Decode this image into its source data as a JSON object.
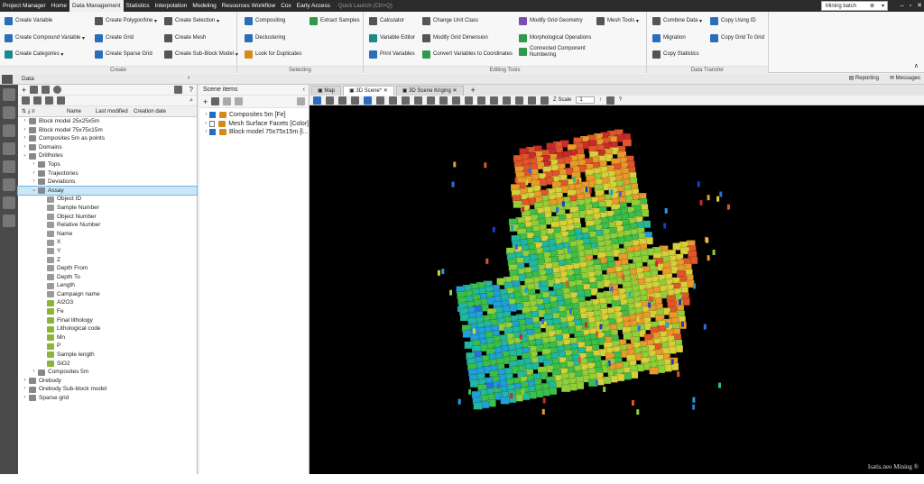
{
  "menubar": {
    "items": [
      "Project Manager",
      "Home",
      "Data Management",
      "Statistics",
      "Interpolation",
      "Modeling",
      "Resources Workflow",
      "Cox",
      "Early Access"
    ],
    "active_index": 2,
    "quick_launch": "Quick Launch (Ctrl+Q)",
    "project_name": "Mining batch"
  },
  "ribbon": {
    "create": {
      "title": "Create",
      "col1": [
        "Create Variable",
        "Create Compound Variable",
        "Create Categories"
      ],
      "col2": [
        "Create Polygon/line",
        "Create Grid",
        "Create Sparse Grid"
      ],
      "col3": [
        "Create Selection",
        "Create Mesh",
        "Create Sub-Block Model"
      ]
    },
    "selecting": {
      "title": "Selecting",
      "col1": [
        "Compositing",
        "Declustering",
        "Look for Duplicates"
      ],
      "col2": [
        "Extract Samples"
      ]
    },
    "editing": {
      "title": "Editing Tools",
      "col1": [
        "Calculator",
        "Variable Editor",
        "Print Variables"
      ],
      "col2": [
        "Change Unit Class",
        "Modify Grid Dimension",
        "Convert Variables to Coordinates"
      ],
      "col3": [
        "Modify Grid Geometry",
        "Morphological Operations",
        "Connected Component Numbering"
      ],
      "col4": [
        "Mesh Tools"
      ]
    },
    "transfer": {
      "title": "Data Transfer",
      "col1": [
        "Combine Data",
        "Migration",
        "Copy Statistics"
      ],
      "col2": [
        "Copy Using ID",
        "Copy Grid To Grid"
      ]
    }
  },
  "tabrow": {
    "left_label": "Data",
    "reporting": "Reporting",
    "messages": "Messages"
  },
  "datapanel": {
    "columns": [
      "Name",
      "Last modified",
      "Creation date"
    ],
    "tree": [
      {
        "label": "Block model 25x25x5m",
        "depth": 0,
        "exp": ">"
      },
      {
        "label": "Block model 75x75x15m",
        "depth": 0,
        "exp": ">"
      },
      {
        "label": "Composites 5m as points",
        "depth": 0,
        "exp": ">"
      },
      {
        "label": "Domains",
        "depth": 0,
        "exp": ">"
      },
      {
        "label": "Drillholes",
        "depth": 0,
        "exp": "v"
      },
      {
        "label": "Tops",
        "depth": 1,
        "exp": ">"
      },
      {
        "label": "Trajectories",
        "depth": 1,
        "exp": ">"
      },
      {
        "label": "Deviations",
        "depth": 1,
        "exp": ">"
      },
      {
        "label": "Assay",
        "depth": 1,
        "exp": "v",
        "selected": true
      },
      {
        "label": "Object ID",
        "depth": 2,
        "exp": ""
      },
      {
        "label": "Sample Number",
        "depth": 2,
        "exp": ""
      },
      {
        "label": "Object Number",
        "depth": 2,
        "exp": ""
      },
      {
        "label": "Relative Number",
        "depth": 2,
        "exp": ""
      },
      {
        "label": "Name",
        "depth": 2,
        "exp": ""
      },
      {
        "label": "X",
        "depth": 2,
        "exp": ""
      },
      {
        "label": "Y",
        "depth": 2,
        "exp": ""
      },
      {
        "label": "Z",
        "depth": 2,
        "exp": ""
      },
      {
        "label": "Depth From",
        "depth": 2,
        "exp": ""
      },
      {
        "label": "Depth To",
        "depth": 2,
        "exp": ""
      },
      {
        "label": "Length",
        "depth": 2,
        "exp": ""
      },
      {
        "label": "Campaign name",
        "depth": 2,
        "exp": ""
      },
      {
        "label": "Al2O3",
        "depth": 2,
        "exp": ""
      },
      {
        "label": "Fe",
        "depth": 2,
        "exp": ""
      },
      {
        "label": "Final lithology",
        "depth": 2,
        "exp": ""
      },
      {
        "label": "Lithological code",
        "depth": 2,
        "exp": ""
      },
      {
        "label": "Mn",
        "depth": 2,
        "exp": ""
      },
      {
        "label": "P",
        "depth": 2,
        "exp": ""
      },
      {
        "label": "Sample length",
        "depth": 2,
        "exp": ""
      },
      {
        "label": "SiO2",
        "depth": 2,
        "exp": ""
      },
      {
        "label": "Composites 5m",
        "depth": 1,
        "exp": ">"
      },
      {
        "label": "Orebody",
        "depth": 0,
        "exp": ">"
      },
      {
        "label": "Orebody Sub-block model",
        "depth": 0,
        "exp": ">"
      },
      {
        "label": "Sparse grid",
        "depth": 0,
        "exp": ">"
      }
    ]
  },
  "scene": {
    "title": "Scene items",
    "items": [
      {
        "label": "Composites 5m [Fe]",
        "checked": true
      },
      {
        "label": "Mesh Surface Facets [Color]",
        "checked": false
      },
      {
        "label": "Block model 75x75x15m [l...",
        "checked": true
      }
    ]
  },
  "viewtabs": [
    "Map",
    "3D Scene*",
    "3D Scene Kriging"
  ],
  "viewtoolbar": {
    "zscale_label": "Z Scale",
    "zscale_value": "1"
  },
  "watermark": "Isatis.neo Mining ®"
}
